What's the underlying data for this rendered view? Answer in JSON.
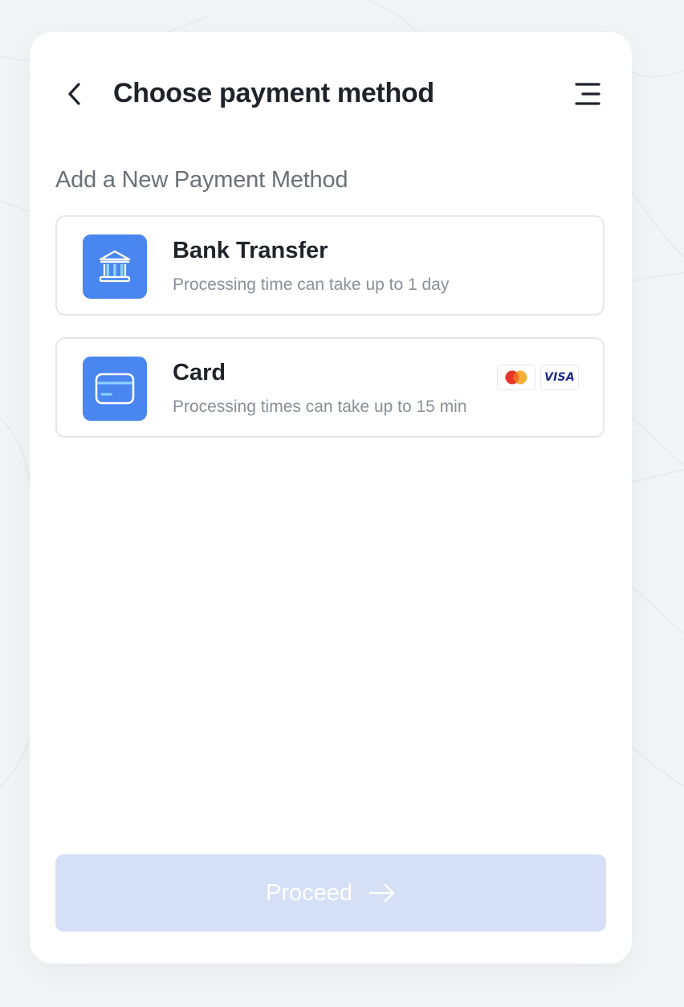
{
  "header": {
    "title": "Choose payment method",
    "back_icon": "chevron-left-icon",
    "menu_icon": "menu-icon"
  },
  "section_label": "Add a New Payment Method",
  "options": [
    {
      "title": "Bank Transfer",
      "subtitle": "Processing time can take up to 1 day",
      "icon": "bank-icon"
    },
    {
      "title": "Card",
      "subtitle": "Processing times can take up to 15 min",
      "icon": "credit-card-icon",
      "brands": [
        "mastercard",
        "VISA"
      ]
    }
  ],
  "proceed_button": {
    "label": "Proceed",
    "icon": "arrow-right-icon",
    "disabled": true
  },
  "colors": {
    "accent": "#4a86f0",
    "button_disabled": "#d5dff5",
    "title_text": "#1f2329",
    "muted_text": "#8a8f98"
  }
}
